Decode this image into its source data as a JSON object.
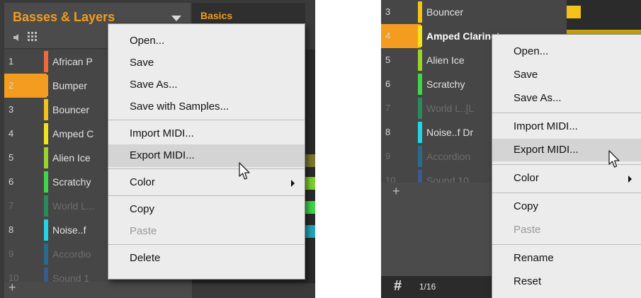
{
  "left": {
    "group_title": "Basses & Layers",
    "section_tab": "Basics",
    "sounds": [
      {
        "num": "1",
        "name": "African P",
        "color": "#f26a3a",
        "empty": false
      },
      {
        "num": "2",
        "name": "Bumper",
        "color": "#f39c1f",
        "empty": false,
        "selected": true
      },
      {
        "num": "3",
        "name": "Bouncer",
        "color": "#f5c21b",
        "empty": false
      },
      {
        "num": "4",
        "name": "Amped C",
        "color": "#f5e21b",
        "empty": false
      },
      {
        "num": "5",
        "name": "Alien Ice",
        "color": "#9ad42a",
        "empty": false
      },
      {
        "num": "6",
        "name": "Scratchy",
        "color": "#3fd64a",
        "empty": false
      },
      {
        "num": "7",
        "name": "World L...",
        "color": "#2a8a5a",
        "empty": true
      },
      {
        "num": "8",
        "name": "Noise..f",
        "color": "#22d4e8",
        "empty": false
      },
      {
        "num": "9",
        "name": "Accordio",
        "color": "#2a6a8a",
        "empty": true
      },
      {
        "num": "10",
        "name": "Sound 1",
        "color": "#3a5a8a",
        "empty": true
      }
    ],
    "add_label": "+",
    "menu": [
      {
        "label": "Open...",
        "disabled": false
      },
      {
        "label": "Save",
        "disabled": false
      },
      {
        "label": "Save As...",
        "disabled": false
      },
      {
        "label": "Save with Samples...",
        "disabled": false
      },
      {
        "label": "Import MIDI...",
        "disabled": false
      },
      {
        "label": "Export MIDI...",
        "disabled": false,
        "hover": true
      },
      {
        "label": "Color",
        "disabled": false,
        "submenu": true
      },
      {
        "label": "Copy",
        "disabled": false
      },
      {
        "label": "Paste",
        "disabled": true
      },
      {
        "label": "Delete",
        "disabled": false
      }
    ]
  },
  "right": {
    "sounds": [
      {
        "num": "3",
        "name": "Bouncer",
        "color": "#f5c21b",
        "empty": false
      },
      {
        "num": "4",
        "name": "Amped Clarinet",
        "color": "#f5e21b",
        "empty": false,
        "selected": true,
        "bright": true
      },
      {
        "num": "5",
        "name": "Alien Ice",
        "color": "#9ad42a",
        "empty": false
      },
      {
        "num": "6",
        "name": "Scratchy",
        "color": "#3fd64a",
        "empty": false
      },
      {
        "num": "7",
        "name": "World L..[L",
        "color": "#2a8a5a",
        "empty": true
      },
      {
        "num": "8",
        "name": "Noise..f Dr",
        "color": "#22d4e8",
        "empty": false
      },
      {
        "num": "9",
        "name": "Accordion",
        "color": "#2a6a8a",
        "empty": true
      },
      {
        "num": "10",
        "name": "Sound 10",
        "color": "#3a5a8a",
        "empty": true
      }
    ],
    "add_label": "+",
    "step_label": "1/16",
    "menu": [
      {
        "label": "Open...",
        "disabled": false
      },
      {
        "label": "Save",
        "disabled": false
      },
      {
        "label": "Save As...",
        "disabled": false
      },
      {
        "label": "Import MIDI...",
        "disabled": false
      },
      {
        "label": "Export MIDI...",
        "disabled": false,
        "hover": true
      },
      {
        "label": "Color",
        "disabled": false,
        "submenu": true
      },
      {
        "label": "Copy",
        "disabled": false
      },
      {
        "label": "Paste",
        "disabled": true
      },
      {
        "label": "Rename",
        "disabled": false
      },
      {
        "label": "Reset",
        "disabled": false
      }
    ]
  },
  "colors": {
    "accent": "#f39c1f",
    "panel_bg": "#3a3a3a",
    "menu_bg": "#ececec"
  }
}
